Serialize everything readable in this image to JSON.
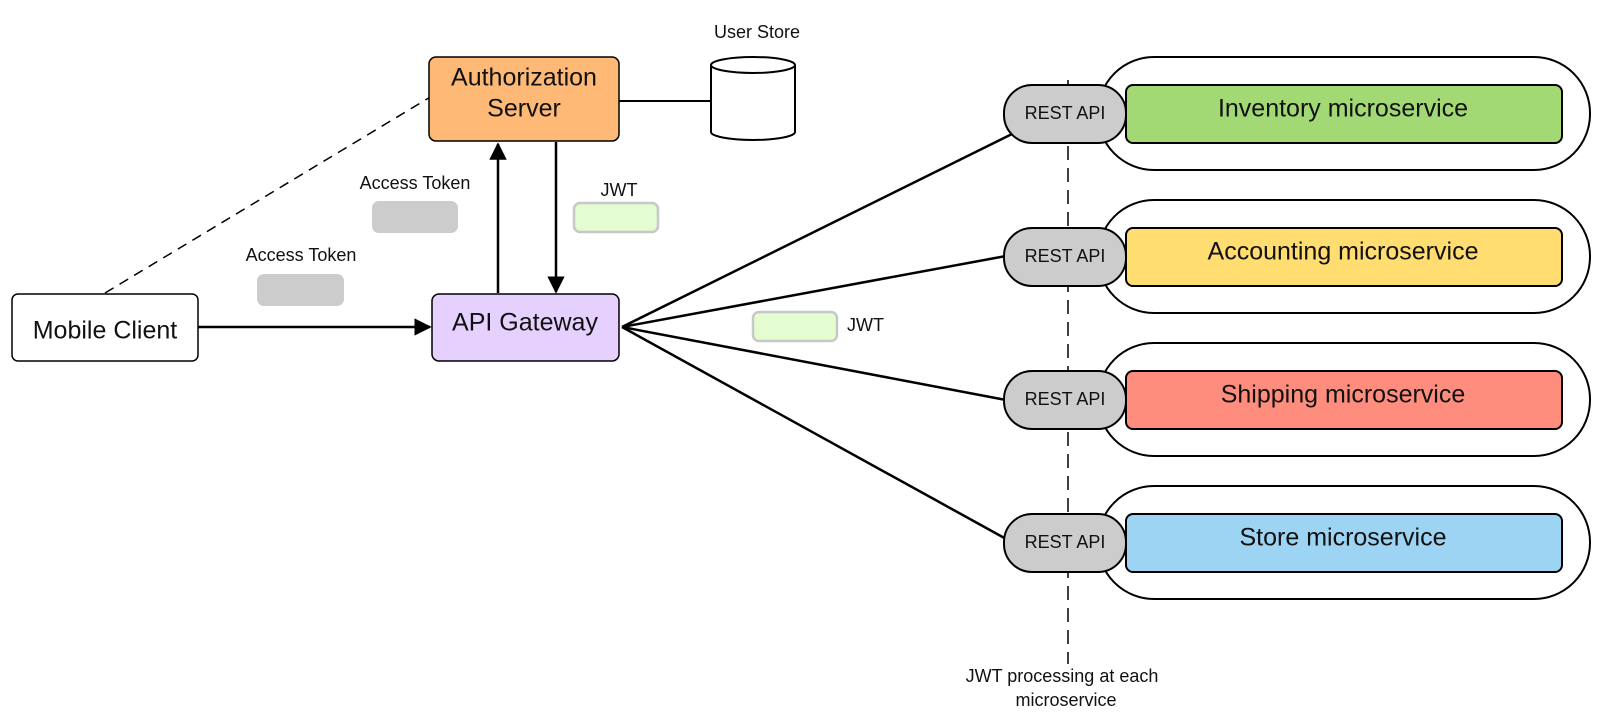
{
  "diagram": {
    "nodes": {
      "mobile_client": {
        "label": "Mobile Client",
        "fill": "#ffffff"
      },
      "auth_server": {
        "label_line1": "Authorization",
        "label_line2": "Server",
        "fill": "#fdb975"
      },
      "api_gateway": {
        "label": "API Gateway",
        "fill": "#e6d1fe"
      },
      "user_store": {
        "label": "User Store",
        "fill": "#ffffff"
      }
    },
    "tokens": {
      "access_token_1": {
        "label": "Access Token",
        "fill": "#cccccc"
      },
      "access_token_2": {
        "label": "Access Token",
        "fill": "#cccccc"
      },
      "jwt_1": {
        "label": "JWT",
        "fill": "#e3fcd0",
        "border": "#c8c8c8"
      },
      "jwt_2": {
        "label": "JWT",
        "fill": "#e3fcd0",
        "border": "#c8c8c8"
      }
    },
    "rest_api_label": "REST API",
    "rest_api_fill": "#cccccc",
    "microservices": [
      {
        "label": "Inventory microservice",
        "fill": "#a2d975"
      },
      {
        "label": "Accounting microservice",
        "fill": "#ffdd71"
      },
      {
        "label": "Shipping microservice",
        "fill": "#ff8d7e"
      },
      {
        "label": "Store microservice",
        "fill": "#9dd3f3"
      }
    ],
    "annotation": {
      "line1": "JWT processing at each",
      "line2": "microservice"
    }
  }
}
